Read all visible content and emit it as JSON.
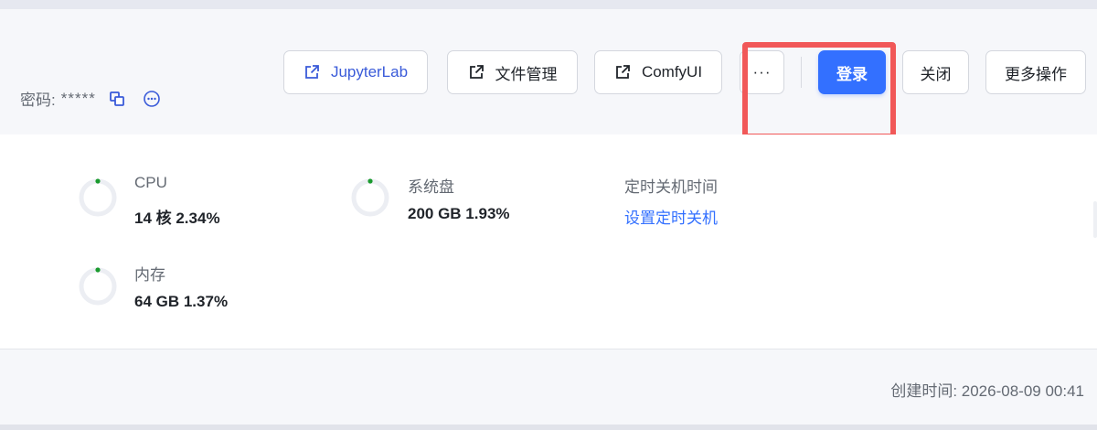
{
  "password": {
    "label": "密码:",
    "value": "*****",
    "copy_icon": "copy-icon",
    "more_icon": "more-circle-icon"
  },
  "toolbar": {
    "jupyter_label": "JupyterLab",
    "files_label": "文件管理",
    "comfy_label": "ComfyUI",
    "more_dots_label": "···",
    "login_label": "登录",
    "close_label": "关闭",
    "more_ops_label": "更多操作",
    "external_link_icon": "external-link-icon"
  },
  "stats": {
    "cpu": {
      "label": "CPU",
      "value": "14 核 2.34%",
      "usage_percent": 2.34
    },
    "disk": {
      "label": "系统盘",
      "value": "200 GB 1.93%",
      "usage_percent": 1.93
    },
    "memory": {
      "label": "内存",
      "value": "64 GB 1.37%",
      "usage_percent": 1.37
    },
    "shutdown": {
      "label": "定时关机时间",
      "link": "设置定时关机"
    }
  },
  "footer": {
    "created": "创建时间: 2026-08-09 00:41"
  },
  "colors": {
    "accent": "#3370ff",
    "highlight": "#f15858",
    "ring_track": "#eceef3",
    "ring_dot": "#1a9a2e"
  }
}
